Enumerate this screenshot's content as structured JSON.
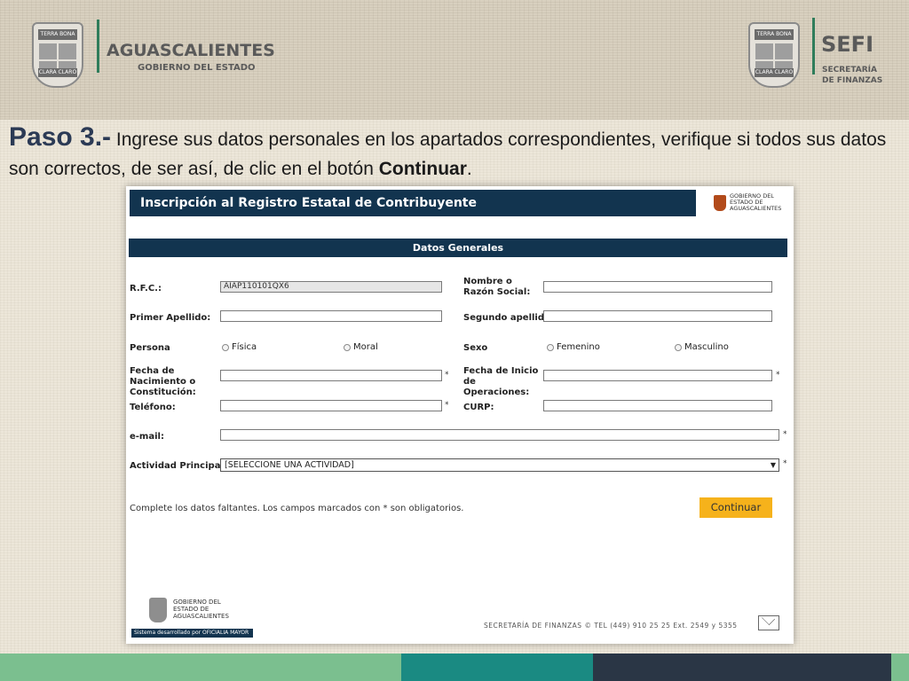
{
  "slide": {
    "left_logo": {
      "motto_top": "TERRA BONA",
      "motto_bottom": "CLARA CLARO",
      "line1": "AGUASCALIENTES",
      "line2": "GOBIERNO DEL ESTADO"
    },
    "right_logo": {
      "motto_top": "TERRA BONA",
      "motto_bottom": "CLARA CLARO",
      "line1": "SEFI",
      "line2": "SECRETARÍA",
      "line3": "DE FINANZAS"
    },
    "instruction": {
      "step": "Paso 3.-",
      "text_a": " Ingrese sus datos personales en los apartados correspondientes, verifique si todos sus datos son correctos, de ser así, de clic en el botón ",
      "bold_word": "Continuar",
      "text_b": "."
    },
    "colors": {
      "navy": "#12344f",
      "button": "#f6b21b",
      "stripe_green": "#7bbf8f",
      "stripe_teal": "#1a8a82",
      "stripe_dark": "#2a3645"
    }
  },
  "form": {
    "header_title": "Inscripción al Registro Estatal de Contribuyente",
    "header_gov": [
      "GOBIERNO DEL",
      "ESTADO DE",
      "AGUASCALIENTES"
    ],
    "section_title": "Datos Generales",
    "labels": {
      "rfc": "R.F.C.:",
      "nombre": "Nombre o Razón Social:",
      "primer_apellido": "Primer Apellido:",
      "segundo_apellido": "Segundo apellido:",
      "persona": "Persona",
      "sexo": "Sexo",
      "fecha_nac": "Fecha de Nacimiento o Constitución:",
      "fecha_inicio": "Fecha de Inicio de Operaciones:",
      "telefono": "Teléfono:",
      "curp": "CURP:",
      "email": "e-mail:",
      "actividad": "Actividad Principal:"
    },
    "values": {
      "rfc": "AIAP110101QX6",
      "actividad": "[SELECCIONE UNA ACTIVIDAD]"
    },
    "radios": {
      "persona": [
        "Física",
        "Moral"
      ],
      "sexo": [
        "Femenino",
        "Masculino"
      ]
    },
    "required_mark": "*",
    "note": "Complete los datos faltantes. Los campos marcados con * son obligatorios.",
    "continue_label": "Continuar",
    "footer": {
      "gov": [
        "GOBIERNO DEL",
        "ESTADO DE",
        "AGUASCALIENTES"
      ],
      "bar": "Sistema desarrollado por OFICIALIA MAYOR",
      "info": "SECRETARÍA DE FINANZAS ©   TEL (449) 910 25 25   Ext. 2549 y 5355"
    }
  }
}
